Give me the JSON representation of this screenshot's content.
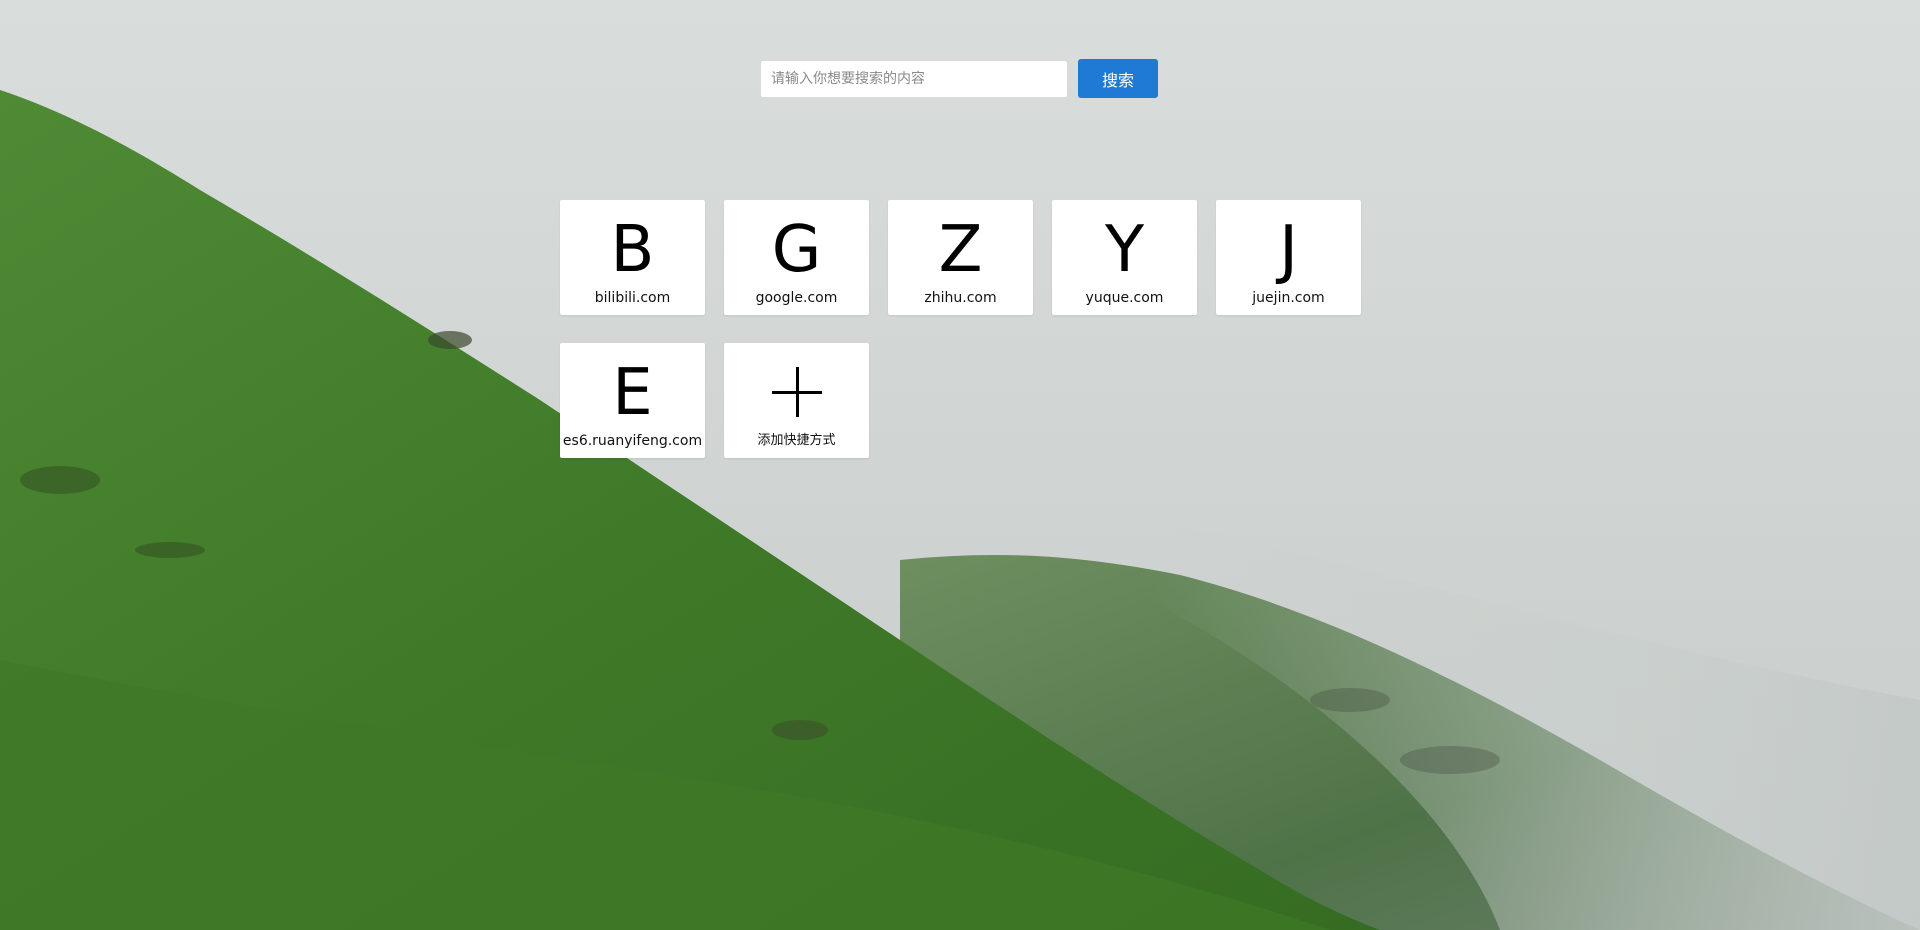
{
  "search": {
    "placeholder": "请输入你想要搜索的内容",
    "value": "",
    "button_label": "搜索"
  },
  "shortcuts": [
    {
      "letter": "B",
      "label": "bilibili.com"
    },
    {
      "letter": "G",
      "label": "google.com"
    },
    {
      "letter": "Z",
      "label": "zhihu.com"
    },
    {
      "letter": "Y",
      "label": "yuque.com"
    },
    {
      "letter": "J",
      "label": "juejin.com"
    },
    {
      "letter": "E",
      "label": "es6.ruanyifeng.com"
    }
  ],
  "add_shortcut": {
    "label": "添加快捷方式",
    "icon": "plus-icon"
  },
  "colors": {
    "search_button": "#1f7ad6",
    "tile_background": "#ffffff"
  }
}
